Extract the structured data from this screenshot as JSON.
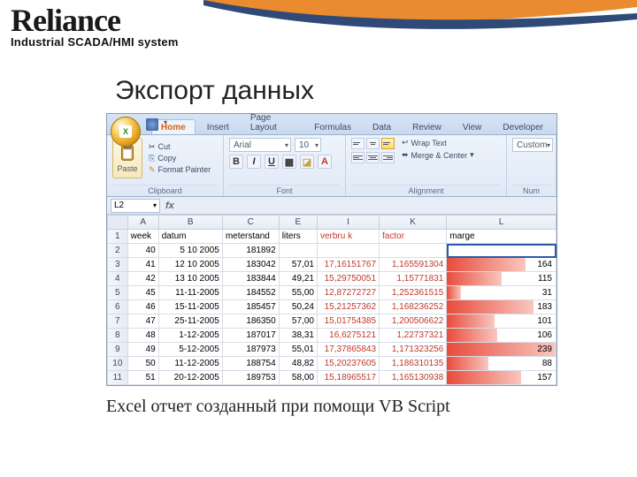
{
  "brand": {
    "name": "Reliance",
    "sub": "Industrial SCADA/HMI system"
  },
  "page_title": "Экспорт данных",
  "caption": "Excel отчет созданный при помощи VB Script",
  "ribbon": {
    "tabs": [
      "Home",
      "Insert",
      "Page Layout",
      "Formulas",
      "Data",
      "Review",
      "View",
      "Developer"
    ],
    "active": 0,
    "clipboard": {
      "label": "Clipboard",
      "paste": "Paste",
      "cut": "Cut",
      "copy": "Copy",
      "painter": "Format Painter"
    },
    "font": {
      "label": "Font",
      "name": "Arial",
      "size": "10"
    },
    "alignment": {
      "label": "Alignment",
      "wrap": "Wrap Text",
      "merge": "Merge & Center"
    },
    "number": {
      "label": "Num",
      "format": "Custom"
    }
  },
  "formula": {
    "namebox": "L2"
  },
  "orb": "X",
  "sheet": {
    "cols": [
      "A",
      "B",
      "C",
      "E",
      "I",
      "K",
      "L"
    ],
    "headers": {
      "week": "week",
      "datum": "datum",
      "meterstand": "meterstand",
      "liters": "liters",
      "verbruik": "verbru k",
      "factor": "factor",
      "marge": "marge"
    },
    "rows": [
      {
        "r": 2,
        "week": "40",
        "datum": "5 10 2005",
        "meterstand": "181892",
        "liters": "",
        "verbruik": "",
        "factor": "",
        "marge": "",
        "bar": 0
      },
      {
        "r": 3,
        "week": "41",
        "datum": "12 10 2005",
        "meterstand": "183042",
        "liters": "57,01",
        "verbruik": "17,16151767",
        "factor": "1,165591304",
        "marge": "164",
        "bar": 0.72
      },
      {
        "r": 4,
        "week": "42",
        "datum": "13 10 2005",
        "meterstand": "183844",
        "liters": "49,21",
        "verbruik": "15,29750051",
        "factor": "1,15771831",
        "marge": "115",
        "bar": 0.5
      },
      {
        "r": 5,
        "week": "45",
        "datum": "11-11-2005",
        "meterstand": "184552",
        "liters": "55,00",
        "verbruik": "12,87272727",
        "factor": "1,252361515",
        "marge": "31",
        "bar": 0.13
      },
      {
        "r": 6,
        "week": "46",
        "datum": "15-11-2005",
        "meterstand": "185457",
        "liters": "50,24",
        "verbruik": "15,21257362",
        "factor": "1,168236252",
        "marge": "183",
        "bar": 0.8
      },
      {
        "r": 7,
        "week": "47",
        "datum": "25-11-2005",
        "meterstand": "186350",
        "liters": "57,00",
        "verbruik": "15,01754385",
        "factor": "1,200506622",
        "marge": "101",
        "bar": 0.44
      },
      {
        "r": 8,
        "week": "48",
        "datum": "1-12-2005",
        "meterstand": "187017",
        "liters": "38,31",
        "verbruik": "16,6275121",
        "factor": "1,22737321",
        "marge": "106",
        "bar": 0.46
      },
      {
        "r": 9,
        "week": "49",
        "datum": "5-12-2005",
        "meterstand": "187973",
        "liters": "55,01",
        "verbruik": "17,37865843",
        "factor": "1,171323256",
        "marge": "239",
        "bar": 1.0
      },
      {
        "r": 10,
        "week": "50",
        "datum": "11-12-2005",
        "meterstand": "188754",
        "liters": "48,82",
        "verbruik": "15,20237605",
        "factor": "1,186310135",
        "marge": "88",
        "bar": 0.38
      },
      {
        "r": 11,
        "week": "51",
        "datum": "20-12-2005",
        "meterstand": "189753",
        "liters": "58,00",
        "verbruik": "15,18965517",
        "factor": "1,165130938",
        "marge": "157",
        "bar": 0.68
      }
    ]
  }
}
